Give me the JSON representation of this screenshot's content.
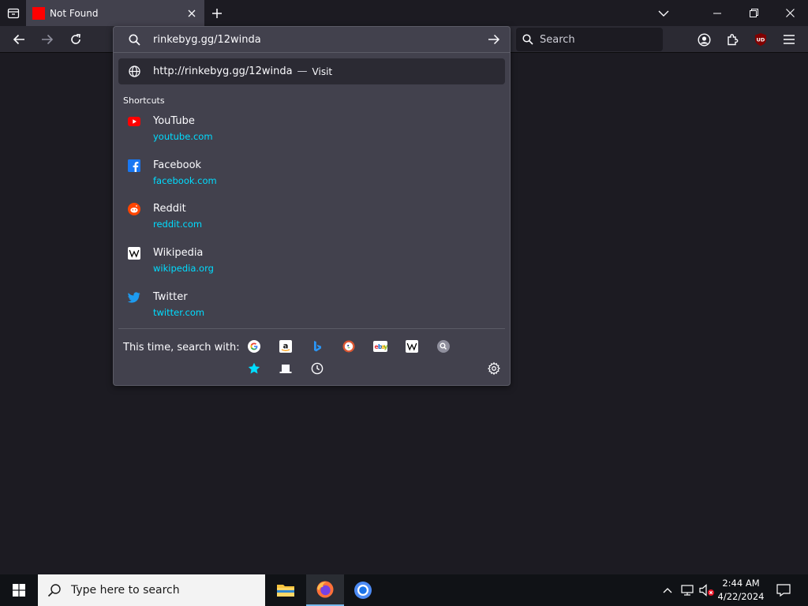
{
  "browser": {
    "tab": {
      "title": "Not Found",
      "favicon_color": "#ff0000"
    },
    "search_placeholder": "Search",
    "addon_badge": "UD"
  },
  "urlbar": {
    "typed_text": "rinkebyg.gg/12winda",
    "visit": {
      "url": "http://rinkebyg.gg/12winda",
      "separator": "—",
      "action": "Visit"
    },
    "section_label": "Shortcuts",
    "shortcuts": [
      {
        "title": "YouTube",
        "url": "youtube.com",
        "icon": "youtube-icon"
      },
      {
        "title": "Facebook",
        "url": "facebook.com",
        "icon": "facebook-icon"
      },
      {
        "title": "Reddit",
        "url": "reddit.com",
        "icon": "reddit-icon"
      },
      {
        "title": "Wikipedia",
        "url": "wikipedia.org",
        "icon": "wikipedia-icon"
      },
      {
        "title": "Twitter",
        "url": "twitter.com",
        "icon": "twitter-icon"
      }
    ],
    "oneoff_label": "This time, search with:",
    "engines": [
      "Google",
      "Amazon",
      "Bing",
      "DuckDuckGo",
      "eBay",
      "Wikipedia",
      "Search",
      "Bookmarks",
      "Tabs",
      "History"
    ]
  },
  "taskbar": {
    "search_placeholder": "Type here to search",
    "time": "2:44 AM",
    "date": "4/22/2024"
  },
  "colors": {
    "accent_link": "#00ddff",
    "panel": "#42414d",
    "toolbar": "#2b2a33",
    "page": "#1c1b22"
  }
}
